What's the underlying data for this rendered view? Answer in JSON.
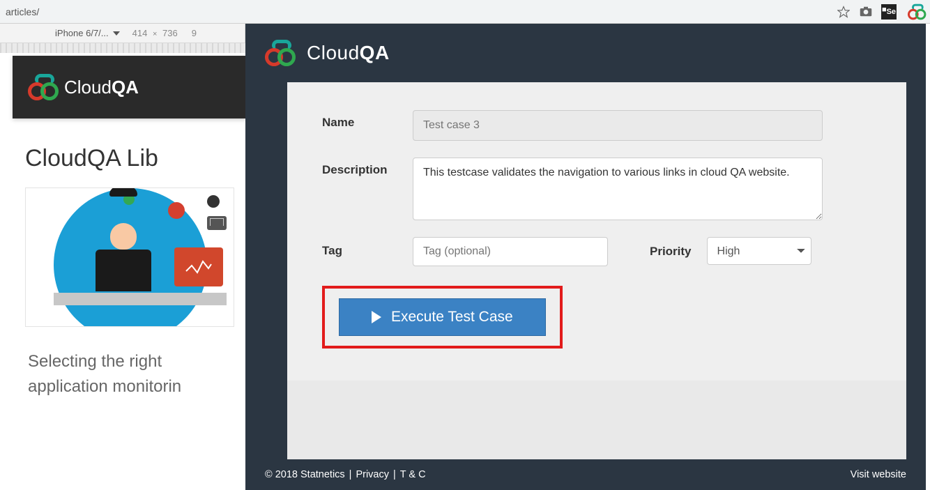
{
  "browser": {
    "url_fragment": "articles/"
  },
  "devtools": {
    "device": "iPhone 6/7/...",
    "width": "414",
    "height": "736",
    "zoom_snippet": "9"
  },
  "mobile_page": {
    "logo_text_a": "Cloud",
    "logo_text_b": "QA",
    "heading": "CloudQA Lib",
    "article_text": "Selecting the right application monitorin"
  },
  "extension": {
    "logo_text_a": "Cloud",
    "logo_text_b": "QA",
    "form": {
      "name_label": "Name",
      "name_placeholder": "Test case 3",
      "description_label": "Description",
      "description_value": "This testcase validates the navigation to various links in cloud QA website.",
      "tag_label": "Tag",
      "tag_placeholder": "Tag (optional)",
      "priority_label": "Priority",
      "priority_value": "High"
    },
    "execute_button_label": "Execute Test Case",
    "footer": {
      "copyright": "© 2018 Statnetics",
      "privacy": "Privacy",
      "tc": "T & C",
      "visit": "Visit website"
    }
  }
}
